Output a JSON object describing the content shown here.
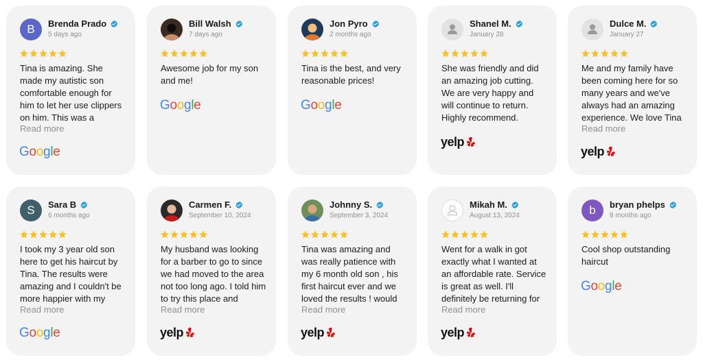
{
  "colors": {
    "card_bg": "#f3f3f3",
    "star": "#fbbf24",
    "verified": "#1d9bf0",
    "yelp_red": "#e00707",
    "read_more": "#8f8f8f"
  },
  "read_more_label": "Read more",
  "google_letters": [
    "G",
    "o",
    "o",
    "g",
    "l",
    "e"
  ],
  "yelp_word": "yelp",
  "reviews": [
    {
      "name": "Brenda Prado",
      "date": "5 days ago",
      "avatar_initial": "B",
      "avatar_color": "#5a67c9",
      "avatar_icon": "initial",
      "rating": 5,
      "text": "Tina is amazing. She made my autistic son comfortable enough for him to let her use clippers on him. This was a",
      "source": "google",
      "truncated": true
    },
    {
      "name": "Bill Walsh",
      "date": "7 days ago",
      "avatar_icon": "photo-man",
      "rating": 5,
      "text": "Awesome job for my son and me!",
      "source": "google",
      "truncated": false
    },
    {
      "name": "Jon Pyro",
      "date": "2 months ago",
      "avatar_icon": "photo-orange",
      "rating": 5,
      "text": "Tina is the best, and very reasonable prices!",
      "source": "google",
      "truncated": false
    },
    {
      "name": "Shanel M.",
      "date": "January 28",
      "avatar_icon": "default-user-icon",
      "rating": 5,
      "text": "She was friendly and did an amazing job cutting. We are very happy and will continue to return. Highly recommend.",
      "source": "yelp",
      "truncated": false
    },
    {
      "name": "Dulce M.",
      "date": "January 27",
      "avatar_icon": "default-user-icon",
      "rating": 5,
      "text": "Me and my family have been coming here for so many years and we've always had an amazing experience. We love Tina",
      "source": "yelp",
      "truncated": true
    },
    {
      "name": "Sara B",
      "date": "6 months ago",
      "avatar_initial": "S",
      "avatar_color": "#3f5f6a",
      "avatar_icon": "initial",
      "rating": 5,
      "text": "I took my 3 year old son here to get his haircut by Tina. The results were amazing and I couldn't be more happier with my",
      "source": "google",
      "truncated": true
    },
    {
      "name": "Carmen F.",
      "date": "September 10, 2024",
      "avatar_icon": "photo-red",
      "rating": 5,
      "text": "My husband was looking for a barber to go to since we had moved to the area not too long ago. I told him to try this place and",
      "source": "yelp",
      "truncated": true
    },
    {
      "name": "Johnny S.",
      "date": "September 3, 2024",
      "avatar_icon": "photo-green",
      "rating": 5,
      "text": "Tina was amazing and was really patience with my 6 month old son , his first haircut ever and we loved the results ! would",
      "source": "yelp",
      "truncated": true
    },
    {
      "name": "Mikah M.",
      "date": "August 13, 2024",
      "avatar_icon": "default-user-outline-icon",
      "rating": 5,
      "text": "Went for a walk in got exactly what I wanted at an affordable rate. Service is great as well. I'll definitely be returning for",
      "source": "yelp",
      "truncated": true
    },
    {
      "name": "bryan phelps",
      "date": "8 months ago",
      "avatar_initial": "b",
      "avatar_color": "#7e57c2",
      "avatar_icon": "initial",
      "rating": 5,
      "text": "Cool shop outstanding haircut",
      "source": "google",
      "truncated": false
    }
  ]
}
